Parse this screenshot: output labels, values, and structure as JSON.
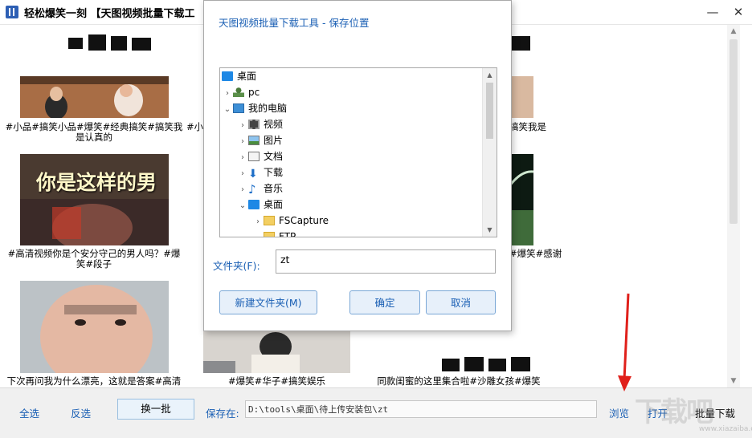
{
  "window": {
    "title": "轻松爆笑一刻 【天图视频批量下载工",
    "minimize": "—",
    "close": "✕"
  },
  "videos": [
    {
      "caption": "#小品#搞笑小品#爆笑#经典搞笑#搞笑我是认真的"
    },
    {
      "caption": "#小"
    },
    {
      "caption": "搞笑我是"
    },
    {
      "caption": "#高清视频你是个安分守己的男人吗？#爆笑#段子",
      "overlay_text": "你是这样的男"
    },
    {
      "caption": "#爆笑#感谢"
    },
    {
      "caption": "下次再问我为什么漂亮，这就是答案#高清"
    },
    {
      "caption": "#爆笑#华子#搞笑娱乐"
    },
    {
      "caption": "同款闺蜜的这里集合啦#沙雕女孩#爆笑"
    }
  ],
  "bottom_bar": {
    "select_all": "全选",
    "invert": "反选",
    "next_batch": "换一批",
    "save_label": "保存在:",
    "save_path": "D:\\tools\\桌面\\待上传安装包\\zt",
    "browse": "浏览",
    "open": "打开",
    "batch_download": "批量下载"
  },
  "dialog": {
    "title": "天图视频批量下载工具 - 保存位置",
    "tree": [
      {
        "label": "桌面",
        "icon": "desktop-icon",
        "level": 0,
        "expand": ""
      },
      {
        "label": "pc",
        "icon": "user-icon",
        "level": 1,
        "expand": "›"
      },
      {
        "label": "我的电脑",
        "icon": "computer-icon",
        "level": 1,
        "expand": "⌄"
      },
      {
        "label": "视频",
        "icon": "video-folder-icon",
        "level": 2,
        "expand": "›"
      },
      {
        "label": "图片",
        "icon": "picture-folder-icon",
        "level": 2,
        "expand": "›"
      },
      {
        "label": "文档",
        "icon": "document-folder-icon",
        "level": 2,
        "expand": "›"
      },
      {
        "label": "下载",
        "icon": "download-folder-icon",
        "level": 2,
        "expand": "›"
      },
      {
        "label": "音乐",
        "icon": "music-folder-icon",
        "level": 2,
        "expand": "›"
      },
      {
        "label": "桌面",
        "icon": "desktop-icon",
        "level": 2,
        "expand": "⌄"
      },
      {
        "label": "FSCapture",
        "icon": "folder-icon",
        "level": 3,
        "expand": "›"
      },
      {
        "label": "FTP",
        "icon": "folder-icon",
        "level": 3,
        "expand": ""
      }
    ],
    "folder_label": "文件夹(F):",
    "folder_value": "zt",
    "new_folder": "新建文件夹(M)",
    "ok": "确定",
    "cancel": "取消"
  },
  "watermark": {
    "text": "下载吧",
    "sub": "www.xiazaiba.com"
  },
  "colors": {
    "link": "#1a5fb4",
    "arrow": "#e0201b"
  }
}
